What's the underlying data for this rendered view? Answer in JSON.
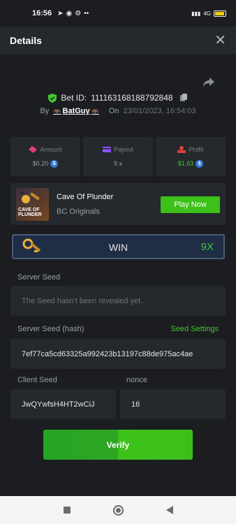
{
  "status_bar": {
    "time": "16:56",
    "network": "4G",
    "battery": "89"
  },
  "header": {
    "title": "Details",
    "close_icon": "close-icon"
  },
  "bet": {
    "id_label": "Bet ID:",
    "id": "111163168188792848",
    "by_label": "By",
    "username": "BatGuy",
    "on_label": "On",
    "datetime": "23/01/2023, 16:54:03"
  },
  "stats": {
    "amount": {
      "label": "Amount",
      "value": "$0.20"
    },
    "payout": {
      "label": "Payout",
      "value": "9 x"
    },
    "profit": {
      "label": "Profit",
      "value": "$1.63"
    }
  },
  "game": {
    "name": "Cave Of Plunder",
    "provider": "BC Originals",
    "thumb_text_1": "CAVE OF",
    "thumb_text_2": "PLUNDER",
    "play_button": "Play Now"
  },
  "result": {
    "label": "WIN",
    "multiplier": "9X"
  },
  "server_seed": {
    "label": "Server Seed",
    "placeholder": "The Seed hasn't been revealed yet."
  },
  "server_seed_hash": {
    "label": "Server Seed (hash)",
    "settings_link": "Seed Settings",
    "value": "7ef77ca5cd63325a992423b13197c88de975ac4ae"
  },
  "client_seed": {
    "label": "Client Seed",
    "value": "JwQYwfsH4HT2wCiJ"
  },
  "nonce": {
    "label": "nonce",
    "value": "16"
  },
  "verify_button": "Verify",
  "colors": {
    "accent_green": "#3bc117",
    "background": "#1b1d21",
    "card": "#25282c"
  }
}
